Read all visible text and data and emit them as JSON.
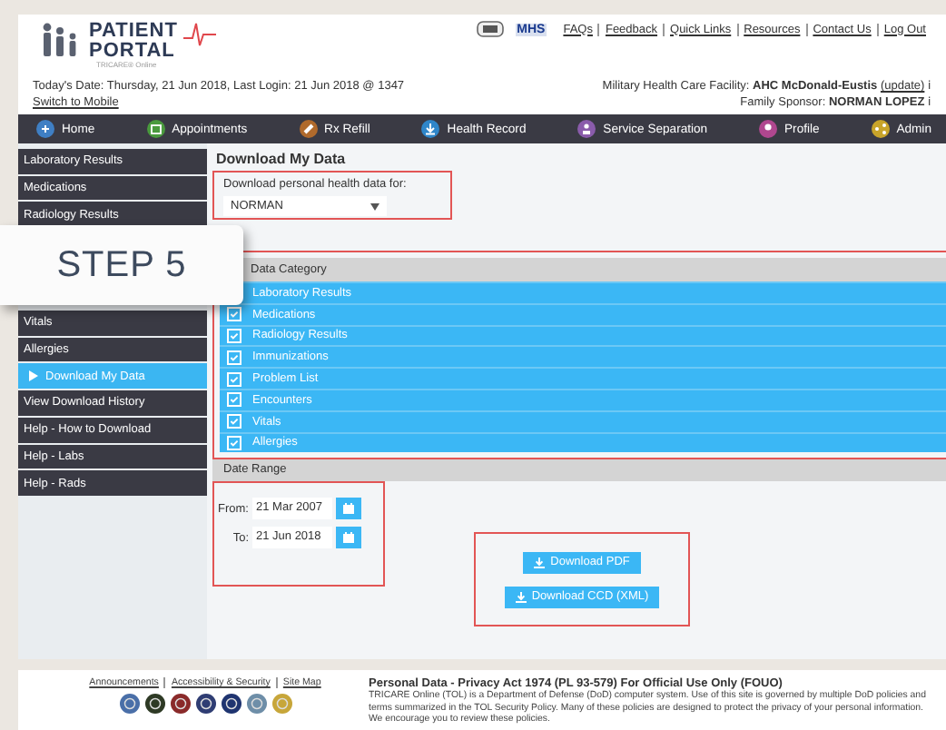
{
  "header": {
    "logo": {
      "line1": "PATIENT",
      "line2": "PORTAL",
      "tagline": "TRICARE® Online"
    },
    "mhs_logo": "MHS",
    "links": [
      "FAQs",
      "Feedback",
      "Quick Links",
      "Resources",
      "Contact Us",
      "Log Out"
    ],
    "date_text": "Today's Date: Thursday, 21 Jun 2018, Last Login: 21 Jun 2018 @ 1347",
    "switch_link": "Switch to Mobile",
    "facility_label": "Military Health Care Facility:",
    "facility": "AHC McDonald-Eustis",
    "facility_link": "(update)",
    "info_mark": "ℹ",
    "sponsor_label": "Family Sponsor:",
    "sponsor": "NORMAN LOPEZ",
    "sponsor_info_mark": "ℹ"
  },
  "nav": [
    {
      "label": "Home"
    },
    {
      "label": "Appointments"
    },
    {
      "label": "Rx Refill"
    },
    {
      "label": "Health Record"
    },
    {
      "label": "Service Separation"
    },
    {
      "label": "Profile"
    },
    {
      "label": "Admin"
    }
  ],
  "sidebar": {
    "items_top": [
      {
        "label": "Laboratory Results",
        "selected": false
      },
      {
        "label": "Medications",
        "selected": false
      },
      {
        "label": "Radiology Results",
        "selected": false
      }
    ],
    "items_bottom": [
      {
        "label": "Vitals",
        "selected": false
      },
      {
        "label": "Allergies",
        "selected": false
      },
      {
        "label": "Download My Data",
        "selected": true
      },
      {
        "label": "View Download History",
        "selected": false
      },
      {
        "label": "Help - How to Download",
        "selected": false
      },
      {
        "label": "Help - Labs",
        "selected": false
      },
      {
        "label": "Help - Rads",
        "selected": false
      }
    ]
  },
  "callout": "STEP 5",
  "content": {
    "title": "Download My Data",
    "person_label": "Download personal health data for:",
    "person_select": "NORMAN",
    "category_heading": "Data Category",
    "categories": [
      {
        "label": "Laboratory Results"
      },
      {
        "label": "Medications",
        "checked": true
      },
      {
        "label": "Radiology Results",
        "checked": true
      },
      {
        "label": "Immunizations",
        "checked": true
      },
      {
        "label": "Problem List",
        "checked": true
      },
      {
        "label": "Encounters",
        "checked": true
      },
      {
        "label": "Vitals",
        "checked": true
      },
      {
        "label": "Allergies",
        "checked": true
      }
    ],
    "date_heading": "Date Range",
    "from_label": "From:",
    "from_value": "21 Mar 2007",
    "to_label": "To:",
    "to_value": "21 Jun 2018",
    "buttons": [
      "Download PDF",
      "Download CCD (XML)"
    ]
  },
  "footer": {
    "links": [
      "Announcements",
      "Accessibility & Security",
      "Site Map"
    ],
    "notice_title": "Personal Data - Privacy Act 1974 (PL 93-579)  For Official Use Only (FOUO)",
    "notice_text": "TRICARE Online (TOL) is a Department of Defense (DoD) computer system. Use of this site is governed by multiple DoD policies and terms summarized in the TOL Security Policy. Many of these policies are designed to protect the privacy of your personal information. We encourage you to review these policies."
  }
}
